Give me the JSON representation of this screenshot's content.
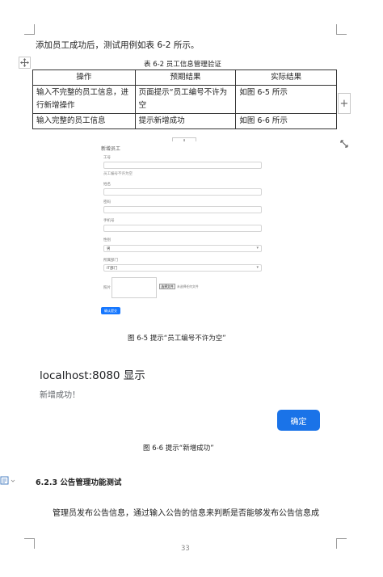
{
  "intro_text": "添加员工成功后，测试用例如表 6-2 所示。",
  "table_caption": "表 6-2  员工信息管理验证",
  "table": {
    "headers": [
      "操作",
      "预期结果",
      "实际结果"
    ],
    "rows": [
      [
        "输入不完整的员工信息，进行新增操作",
        "页面提示“员工编号不许为空",
        "如图 6-5 所示"
      ],
      [
        "输入完整的员工信息",
        "提示新增成功",
        "如图 6-6 所示"
      ]
    ]
  },
  "form": {
    "title": "新增员工",
    "fields": [
      {
        "label": "工号",
        "value": ""
      },
      {
        "label": "员工编号不许为空",
        "value": ""
      },
      {
        "label": "姓名",
        "value": ""
      },
      {
        "label": "密码",
        "value": ""
      },
      {
        "label": "手机号",
        "value": ""
      },
      {
        "label": "性别",
        "value": "男"
      },
      {
        "label": "所属部门",
        "value": "IT部门"
      }
    ],
    "photo_label": "照片",
    "file_button": "选择文件",
    "file_status": "未选择任何文件",
    "submit_label": "确认提交"
  },
  "figure_caption_1": "图 6-5  提示“员工编号不许为空”",
  "dialog": {
    "title": "localhost:8080 显示",
    "message": "新增成功！",
    "confirm_label": "确定"
  },
  "figure_caption_2": "图 6-6  提示“新增成功”",
  "section_heading": "6.2.3  公告管理功能测试",
  "body_text": "管理员发布公告信息，通过输入公告的信息来判断是否能够发布公告信息成",
  "page_number": "33",
  "handles": {
    "add_row": "+",
    "add_column": "+"
  },
  "colors": {
    "primary_button": "#1a73e8",
    "form_submit": "#1677ff"
  }
}
